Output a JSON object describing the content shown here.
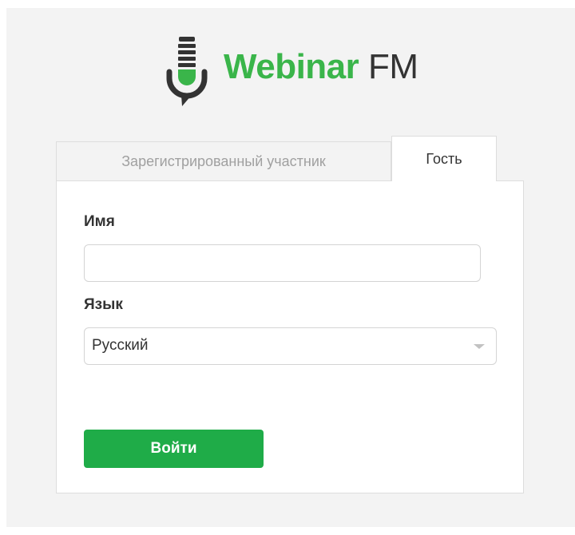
{
  "brand": {
    "name": "Webinar",
    "suffix": "FM",
    "accent_color": "#3ab54a",
    "logo_icon": "microphone-icon"
  },
  "tabs": [
    {
      "label": "Зарегистрированный участник",
      "active": false
    },
    {
      "label": "Гость",
      "active": true
    }
  ],
  "form": {
    "name_label": "Имя",
    "name_value": "",
    "name_placeholder": "",
    "language_label": "Язык",
    "language_selected": "Русский",
    "submit_label": "Войти",
    "submit_color": "#1fac48"
  }
}
